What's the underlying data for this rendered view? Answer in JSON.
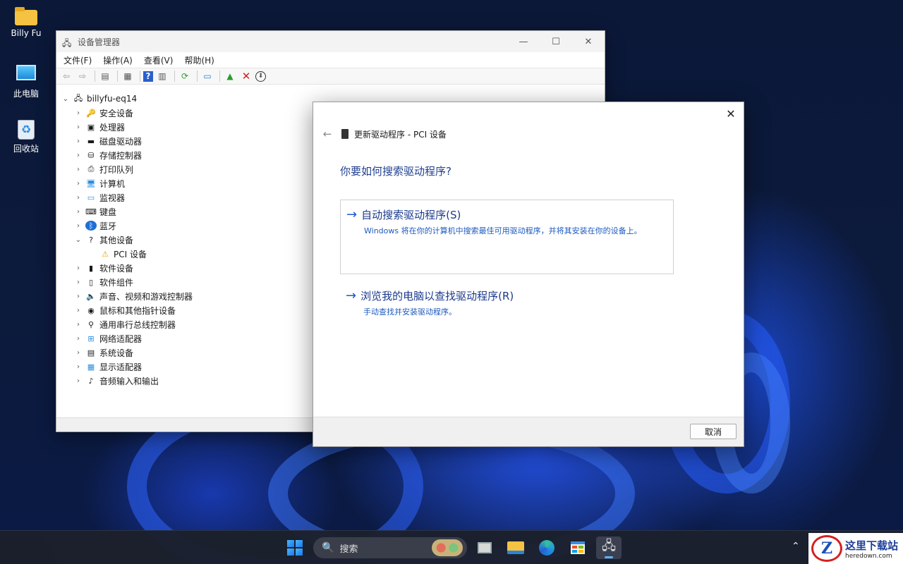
{
  "desktop": {
    "icons": [
      {
        "label": "Billy Fu",
        "icon": "folder-icon"
      },
      {
        "label": "此电脑",
        "icon": "computer-icon"
      },
      {
        "label": "回收站",
        "icon": "recycle-bin-icon"
      }
    ]
  },
  "device_manager": {
    "title": "设备管理器",
    "menu": [
      "文件(F)",
      "操作(A)",
      "查看(V)",
      "帮助(H)"
    ],
    "root": "billyfu-eq14",
    "tree": [
      {
        "label": "安全设备",
        "icon": "security-key-icon",
        "expanded": false
      },
      {
        "label": "处理器",
        "icon": "processor-icon",
        "expanded": false
      },
      {
        "label": "磁盘驱动器",
        "icon": "disk-drive-icon",
        "expanded": false
      },
      {
        "label": "存储控制器",
        "icon": "storage-controller-icon",
        "expanded": false
      },
      {
        "label": "打印队列",
        "icon": "printer-icon",
        "expanded": false
      },
      {
        "label": "计算机",
        "icon": "computer-icon",
        "expanded": false
      },
      {
        "label": "监视器",
        "icon": "monitor-icon",
        "expanded": false
      },
      {
        "label": "键盘",
        "icon": "keyboard-icon",
        "expanded": false
      },
      {
        "label": "蓝牙",
        "icon": "bluetooth-icon",
        "expanded": false
      },
      {
        "label": "其他设备",
        "icon": "unknown-device-icon",
        "expanded": true
      },
      {
        "label": "PCI 设备",
        "icon": "warning-device-icon",
        "child": true
      },
      {
        "label": "软件设备",
        "icon": "software-device-icon",
        "expanded": false
      },
      {
        "label": "软件组件",
        "icon": "software-component-icon",
        "expanded": false
      },
      {
        "label": "声音、视频和游戏控制器",
        "icon": "speaker-icon",
        "expanded": false
      },
      {
        "label": "鼠标和其他指针设备",
        "icon": "mouse-icon",
        "expanded": false
      },
      {
        "label": "通用串行总线控制器",
        "icon": "usb-icon",
        "expanded": false
      },
      {
        "label": "网络适配器",
        "icon": "network-adapter-icon",
        "expanded": false
      },
      {
        "label": "系统设备",
        "icon": "system-device-icon",
        "expanded": false
      },
      {
        "label": "显示适配器",
        "icon": "display-adapter-icon",
        "expanded": false
      },
      {
        "label": "音频输入和输出",
        "icon": "audio-io-icon",
        "expanded": false
      }
    ]
  },
  "dialog": {
    "header": "更新驱动程序 - PCI 设备",
    "question": "你要如何搜索驱动程序?",
    "option1_title": "自动搜索驱动程序(S)",
    "option1_desc": "Windows 将在你的计算机中搜索最佳可用驱动程序，并将其安装在你的设备上。",
    "option2_title": "浏览我的电脑以查找驱动程序(R)",
    "option2_desc": "手动查找并安装驱动程序。",
    "cancel_label": "取消"
  },
  "taskbar": {
    "search_label": "搜索"
  },
  "watermark": {
    "cn": "这里下载站",
    "en": "heredown.com"
  }
}
